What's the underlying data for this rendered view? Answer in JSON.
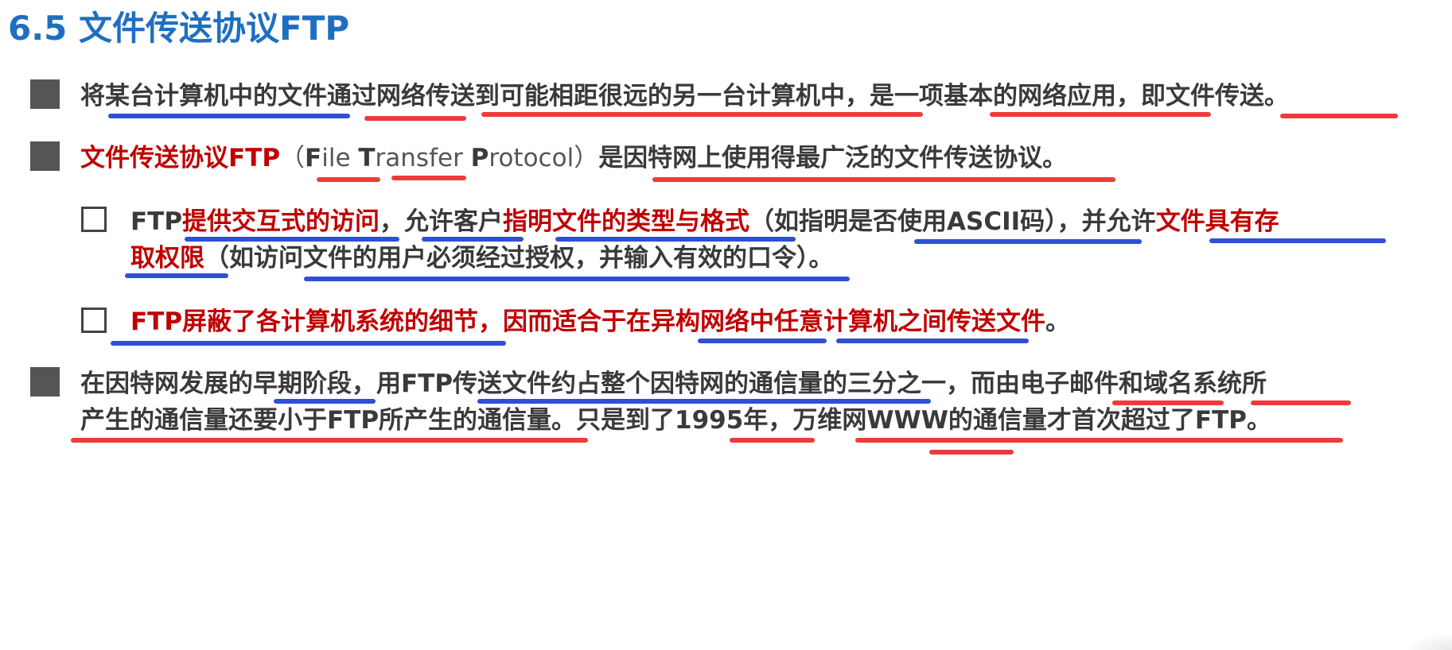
{
  "title": "6.5 文件传送协议FTP",
  "bullets": {
    "b1": {
      "t1": "将某台计算机中的文件通过网络传送到可能相距很远的另一台计算机中，是一项基本的网络应用，即文件传送。"
    },
    "b2": {
      "red": "文件传送协议FTP",
      "paren_open": "（",
      "f": "F",
      "ile": "ile ",
      "t": "T",
      "ransfer": "ransfer ",
      "p": "P",
      "rotocol": "rotocol",
      "paren_close": "）",
      "rest": "是因特网上使用得最广泛的文件传送协议。"
    },
    "s1": {
      "a": "FTP",
      "b": "提供交互式的访问",
      "c": "，允许客户",
      "d": "指明文件的类型与格式",
      "e": "（如指明是否使用ASCII码），并允许",
      "f": "文件具有存",
      "g": "取权限",
      "h": "（如访问文件的用户必须经过授权，并输入有效的口令）。"
    },
    "s2": {
      "red": "FTP屏蔽了各计算机系统的细节，因而适合于在异构网络中任意计算机之间传送文件",
      "end": "。"
    },
    "b3": {
      "line1": "在因特网发展的早期阶段，用FTP传送文件约占整个因特网的通信量的三分之一，而由电子邮件和域名系统所",
      "line2": "产生的通信量还要小于FTP所产生的通信量。只是到了1995年，万维网WWW的通信量才首次超过了FTP。"
    }
  },
  "colors": {
    "title": "#1f6fc1",
    "emphasis_red": "#c00000",
    "underline_blue": "#2f4fd8",
    "underline_red": "#f03a3a"
  }
}
